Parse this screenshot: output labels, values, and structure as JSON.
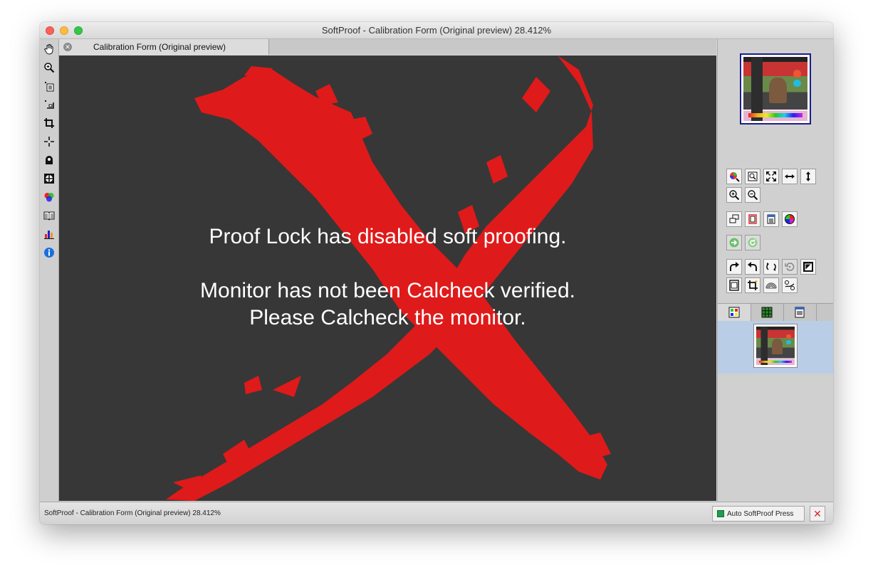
{
  "window": {
    "title": "SoftProof - Calibration Form (Original preview) 28.412%"
  },
  "tab": {
    "label": "Calibration Form (Original preview)"
  },
  "canvas": {
    "message_line1": "Proof Lock has disabled soft proofing.",
    "message_line2": "Monitor has not been Calcheck verified.",
    "message_line3": "Please Calcheck the monitor.",
    "background_color": "#373737",
    "x_mark_color": "#df1a1a"
  },
  "left_toolbar": {
    "tools": [
      "hand-icon",
      "zoom-icon",
      "page-list-icon",
      "crop-corner-icon",
      "crop-icon",
      "crosshair-icon",
      "densitometer-icon",
      "target-icon",
      "color-channels-icon",
      "book-icon",
      "chart-bars-icon",
      "info-icon"
    ]
  },
  "right_panel": {
    "view_tabs": [
      "grid-view-icon",
      "green-grid-view-icon",
      "list-view-icon"
    ]
  },
  "status_bar": {
    "text": "SoftProof - Calibration Form (Original preview) 28.412%",
    "auto_button_label": "Auto SoftProof Press",
    "auto_indicator_color": "#1d9e4e",
    "close_label": "✕"
  }
}
